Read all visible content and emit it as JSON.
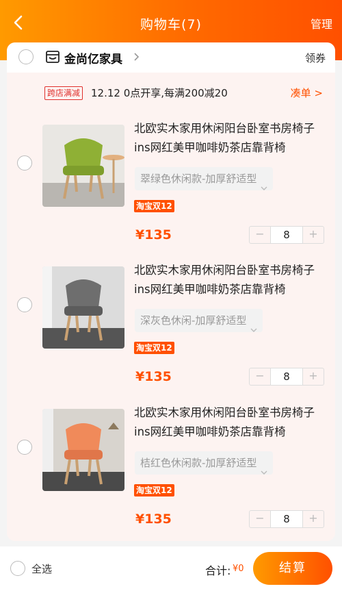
{
  "header": {
    "title": "购物车(7)",
    "manage_label": "管理",
    "back_icon": "chevron-left-icon"
  },
  "store": {
    "name": "金尚亿家具",
    "coupon_label": "领券",
    "promo_tag": "跨店满减",
    "promo_text": "12.12 0点开享,每满200减20",
    "promo_link": "凑单 >"
  },
  "items": [
    {
      "title": "北欧实木家用休闲阳台卧室书房椅子ins网红美甲咖啡奶茶店靠背椅",
      "sku": "翠绿色休闲款-加厚舒适型",
      "badge": "淘宝双12",
      "price": "¥135",
      "quantity": "8",
      "image_color": "#8fb035"
    },
    {
      "title": "北欧实木家用休闲阳台卧室书房椅子ins网红美甲咖啡奶茶店靠背椅",
      "sku": "深灰色休闲-加厚舒适型",
      "badge": "淘宝双12",
      "price": "¥135",
      "quantity": "8",
      "image_color": "#6e6e6e"
    },
    {
      "title": "北欧实木家用休闲阳台卧室书房椅子ins网红美甲咖啡奶茶店靠背椅",
      "sku": "桔红色休闲款-加厚舒适型",
      "badge": "淘宝双12",
      "price": "¥135",
      "quantity": "8",
      "image_color": "#f08a5a"
    }
  ],
  "stepper": {
    "minus": "−",
    "plus": "+"
  },
  "footer": {
    "select_all_label": "全选",
    "total_label": "合计:",
    "total_value": "¥0",
    "checkout_label": "结算"
  },
  "colors": {
    "accent": "#ff5000",
    "header_gradient_start": "#ff9a00",
    "card_bg": "#fdf3f1"
  }
}
